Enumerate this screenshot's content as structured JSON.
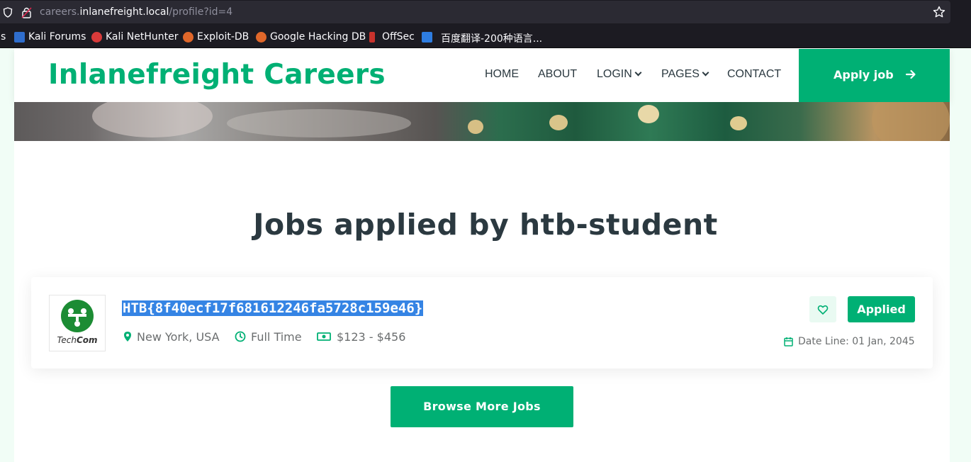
{
  "browser": {
    "url_scheme": "careers.",
    "url_host": "inlanefreight.local",
    "url_path": "/profile?id=4",
    "bookmarks": [
      {
        "label": "s"
      },
      {
        "label": "Kali Forums"
      },
      {
        "label": "Kali NetHunter"
      },
      {
        "label": "Exploit-DB"
      },
      {
        "label": "Google Hacking DB"
      },
      {
        "label": "OffSec"
      },
      {
        "label": "百度翻译-200种语言..."
      }
    ]
  },
  "header": {
    "brand": "Inlanefreight Careers",
    "nav": [
      {
        "label": "HOME"
      },
      {
        "label": "ABOUT"
      },
      {
        "label": "LOGIN"
      },
      {
        "label": "PAGES"
      },
      {
        "label": "CONTACT"
      }
    ],
    "apply_label": "Apply job"
  },
  "main": {
    "title": "Jobs applied by htb-student",
    "job": {
      "company_logo_text_light": "Tech",
      "company_logo_text_bold": "Com",
      "title": "HTB{8f40ecf17f681612246fa5728c159e46}",
      "location": "New York, USA",
      "type": "Full Time",
      "salary": "$123 - $456",
      "status_label": "Applied",
      "date_line": "Date Line: 01 Jan, 2045"
    },
    "browse_label": "Browse More Jobs"
  },
  "colors": {
    "accent": "#00b074",
    "heading": "#2b3940",
    "selection": "#3584e4"
  }
}
